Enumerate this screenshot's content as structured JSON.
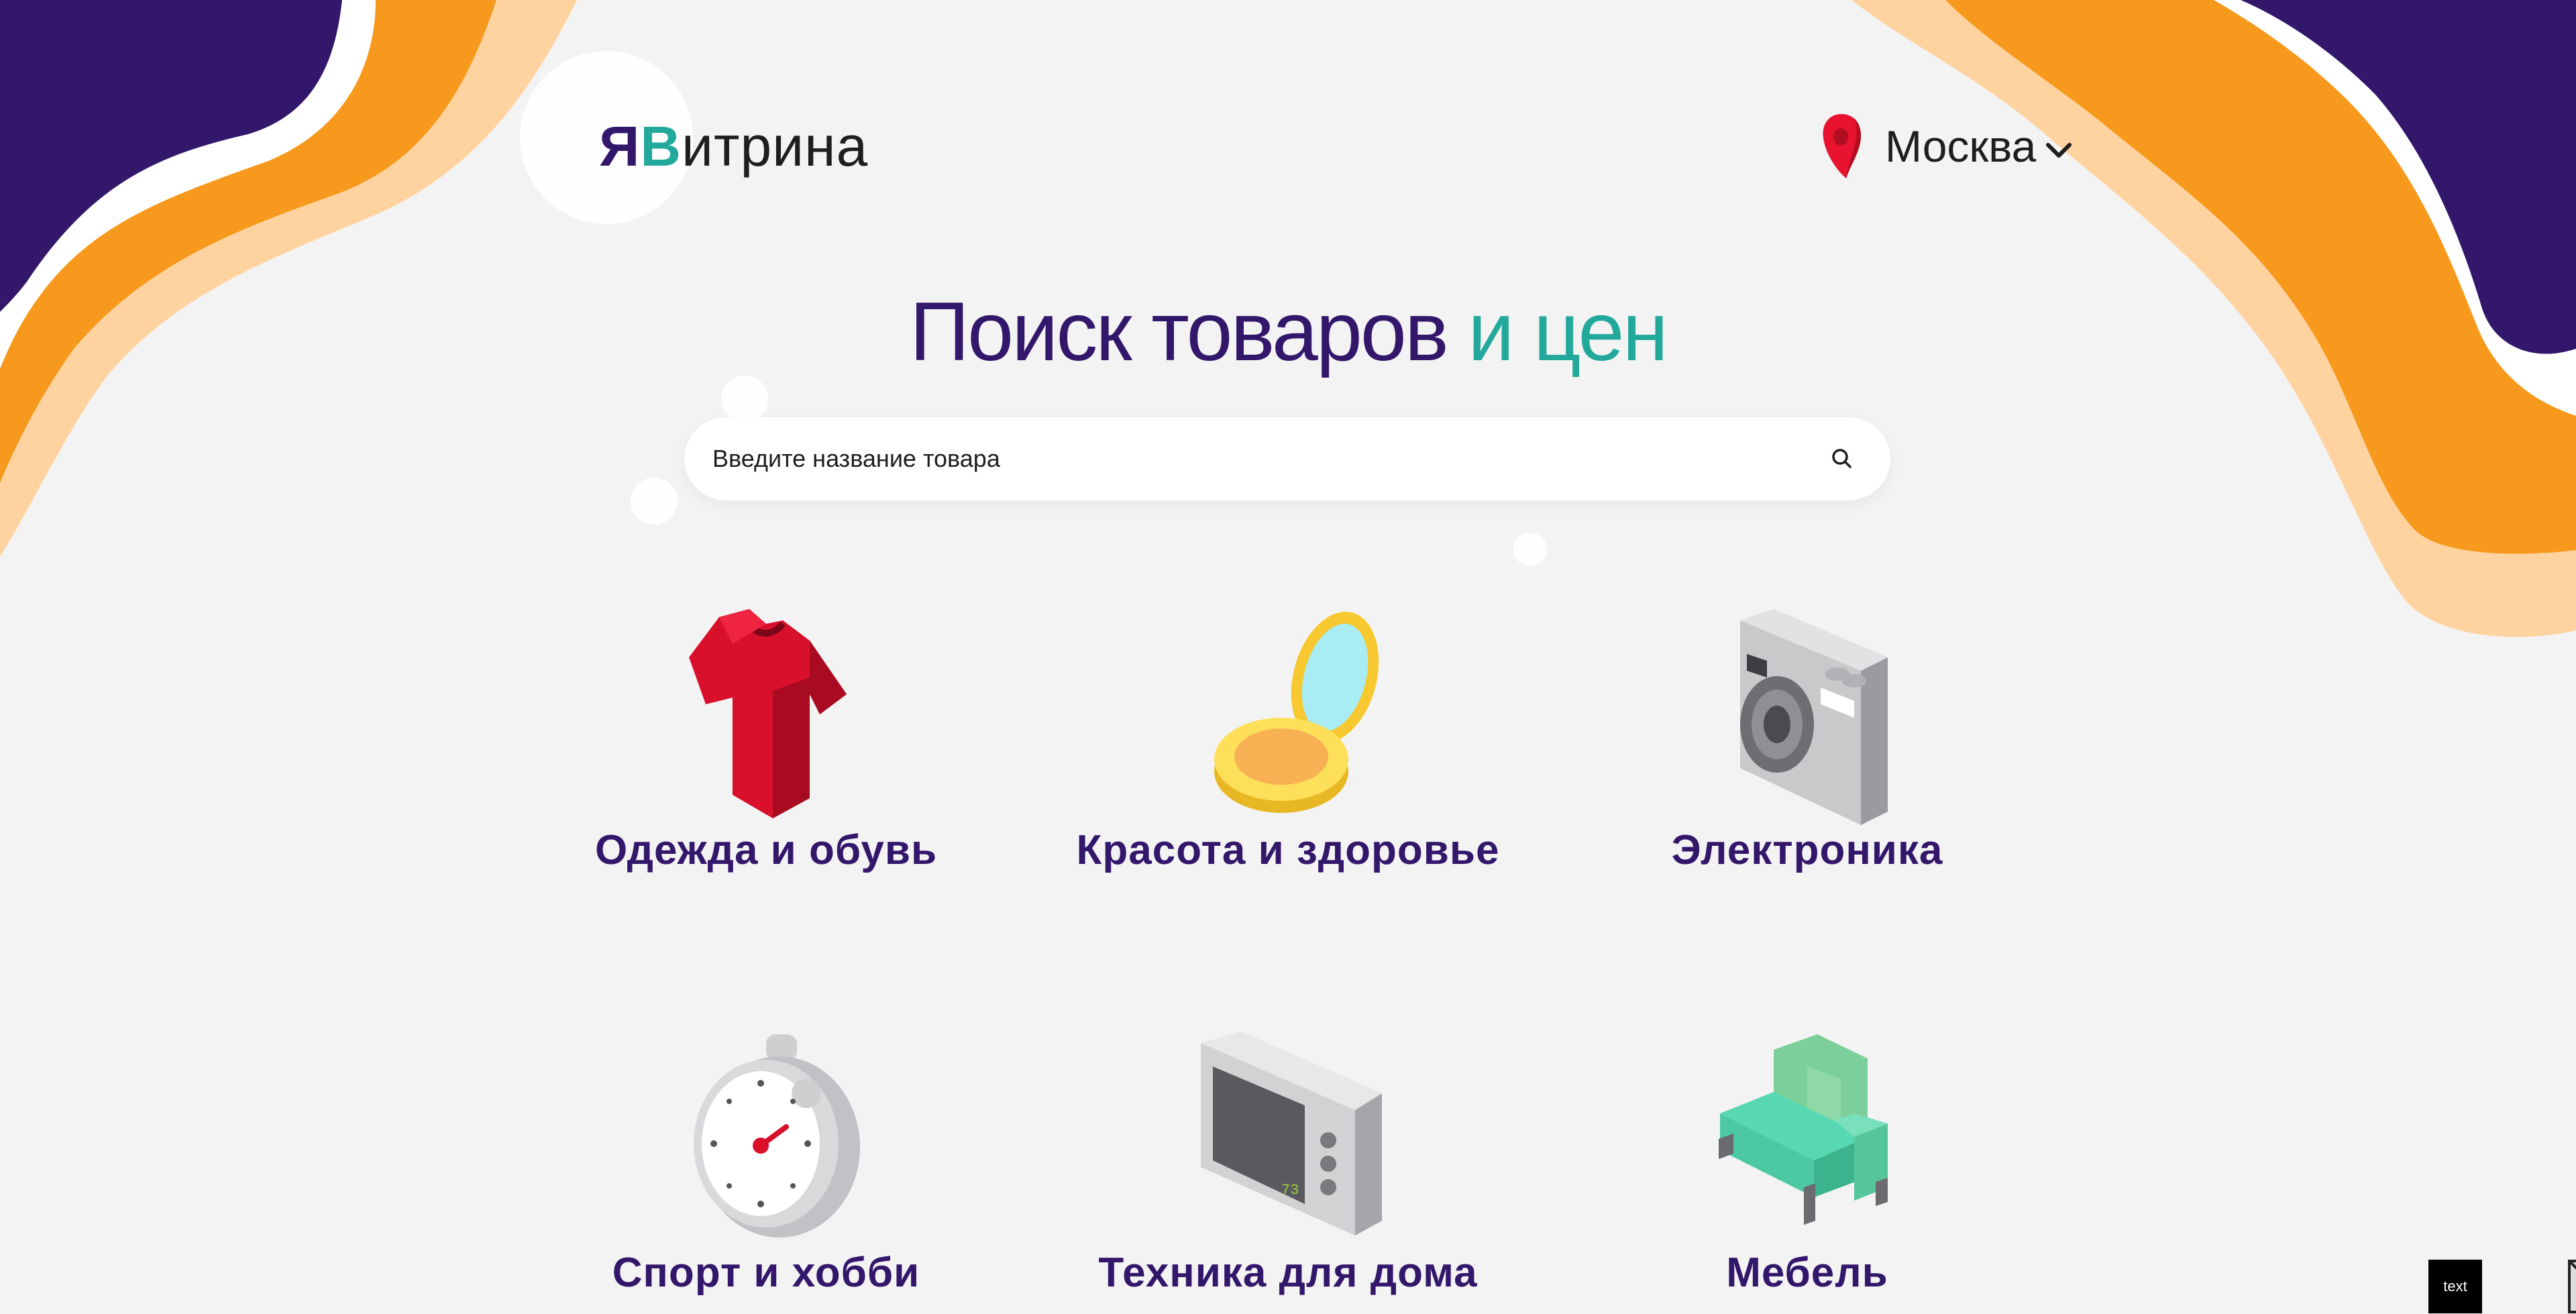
{
  "logo": {
    "part1": "Я",
    "part2": "В",
    "part3": "итрина"
  },
  "location": {
    "city": "Москва",
    "pin_icon": "location-pin-icon",
    "chevron_icon": "chevron-down-icon"
  },
  "hero": {
    "title_main": "Поиск товаров",
    "title_accent": "и цен"
  },
  "search": {
    "placeholder": "Введите название товара",
    "value": "",
    "icon": "search-icon"
  },
  "categories": [
    {
      "label": "Одежда и обувь",
      "icon": "tshirt-icon"
    },
    {
      "label": "Красота и здоровье",
      "icon": "compact-mirror-icon"
    },
    {
      "label": "Электроника",
      "icon": "camera-icon"
    },
    {
      "label": "Спорт и хобби",
      "icon": "stopwatch-icon"
    },
    {
      "label": "Техника для дома",
      "icon": "microwave-icon"
    },
    {
      "label": "Мебель",
      "icon": "sofa-icon"
    }
  ],
  "corner_widget": {
    "label": "text"
  },
  "colors": {
    "brand_purple": "#33176b",
    "brand_teal": "#23a99c",
    "wave_orange": "#f7991c",
    "wave_peach": "#ffd3a0",
    "background": "#f3f3f3"
  }
}
